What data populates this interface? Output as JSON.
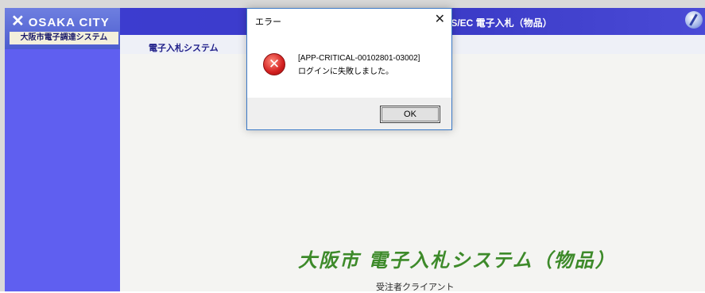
{
  "window": {
    "logo_text": "OSAKA CITY",
    "logo_subtitle": "大阪市電子調達システム",
    "header_title": "LS/EC 電子入札（物品）",
    "tab_primary": "電子入札システム",
    "tab_secondary": "（",
    "main_title": "大阪市 電子入札システム（物品）",
    "main_subtitle": "受注者クライアント"
  },
  "dialog": {
    "title": "エラー",
    "close_glyph": "✕",
    "icon_glyph": "✕",
    "message_line1": "[APP-CRITICAL-00102801-03002]",
    "message_line2": "ログインに失敗しました。",
    "ok_label": "OK"
  },
  "colors": {
    "sidebar": "#5f5ff0",
    "header": "#3c3ccf",
    "title_green": "#3d8a2a",
    "error_red": "#d32020"
  },
  "icons": [
    "x-logo-icon",
    "header-globe-icon",
    "error-icon",
    "close-icon"
  ]
}
